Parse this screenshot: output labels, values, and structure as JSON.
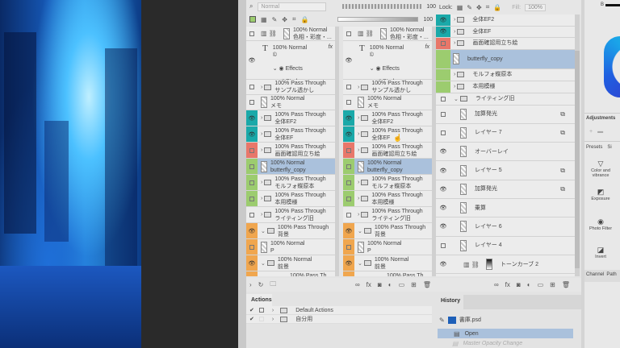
{
  "layers_panel": {
    "blend_mode": "Normal",
    "opacity": "100",
    "fill": "100",
    "rows": [
      {
        "title": "100% Normal",
        "sub": "色相・彩度・...",
        "vis": "box",
        "color": "",
        "kind": "adj"
      },
      {
        "title": "100% Normal",
        "sub": "©",
        "vis": "eye",
        "color": "",
        "kind": "text",
        "fx": "fx"
      },
      {
        "title": "Effects",
        "sub": "",
        "vis": "",
        "color": "",
        "kind": "effects"
      },
      {
        "title": "Stroke",
        "sub": "",
        "vis": "",
        "color": "",
        "kind": "stroke"
      },
      {
        "title": "100% Pass Through",
        "sub": "サンプル透かし",
        "vis": "box",
        "color": "",
        "kind": "folder"
      },
      {
        "title": "100% Normal",
        "sub": "メモ",
        "vis": "box",
        "color": "",
        "kind": "layer"
      },
      {
        "title": "100% Pass Through",
        "sub": "全体EF2",
        "vis": "eye",
        "color": "#1aa9a9",
        "kind": "folder"
      },
      {
        "title": "100% Pass Through",
        "sub": "全体EF",
        "vis": "eye",
        "color": "#1aa9a9",
        "kind": "folder"
      },
      {
        "title": "100% Pass Through",
        "sub": "画面確認用立ち絵",
        "vis": "box",
        "color": "#e8776a",
        "kind": "folder"
      },
      {
        "title": "100% Normal",
        "sub": "butterfly_copy",
        "vis": "box",
        "color": "#9ccc6f",
        "kind": "layer",
        "sel": true
      },
      {
        "title": "100% Pass Through",
        "sub": "モルフォ蝶原本",
        "vis": "box",
        "color": "#9ccc6f",
        "kind": "folder"
      },
      {
        "title": "100% Pass Through",
        "sub": "本用模様",
        "vis": "box",
        "color": "#9ccc6f",
        "kind": "folder"
      },
      {
        "title": "100% Pass Through",
        "sub": "ライティング旧",
        "vis": "box",
        "color": "",
        "kind": "folder"
      },
      {
        "title": "100% Pass Through",
        "sub": "背景",
        "vis": "eye",
        "color": "#f0a64e",
        "kind": "open"
      },
      {
        "title": "100% Normal",
        "sub": "P",
        "vis": "box",
        "color": "#f0a64e",
        "kind": "layer"
      },
      {
        "title": "100% Normal",
        "sub": "前景",
        "vis": "eye",
        "color": "#f0a64e",
        "kind": "open"
      },
      {
        "title": "100% Pass Th",
        "sub": "",
        "vis": "",
        "color": "#f0a64e",
        "kind": "partial"
      }
    ]
  },
  "actions": {
    "title": "Actions",
    "items": [
      "Default Actions",
      "自分用"
    ]
  },
  "layers2": {
    "lock_label": "Lock:",
    "fill_label": "Fill:",
    "fill_value": "100%",
    "rows": [
      {
        "name": "全体EF2",
        "vis": "eye",
        "color": "#1aa9a9",
        "kind": "folder"
      },
      {
        "name": "全体EF",
        "vis": "eye",
        "color": "#1aa9a9",
        "kind": "folder"
      },
      {
        "name": "画面確認用立ち絵",
        "vis": "box",
        "color": "#e8776a",
        "kind": "folder"
      },
      {
        "name": "butterfly_copy",
        "vis": "",
        "color": "#9ccc6f",
        "kind": "layer",
        "sel": true
      },
      {
        "name": "モルフォ蝶原本",
        "vis": "",
        "color": "#9ccc6f",
        "kind": "folder"
      },
      {
        "name": "本用模様",
        "vis": "",
        "color": "#9ccc6f",
        "kind": "folder"
      },
      {
        "name": "ライティング旧",
        "vis": "box",
        "color": "",
        "kind": "open"
      },
      {
        "name": "加算発光",
        "vis": "box",
        "color": "",
        "kind": "layer",
        "clip": true
      },
      {
        "name": "レイヤー 7",
        "vis": "box",
        "color": "",
        "kind": "layer",
        "clip": true
      },
      {
        "name": "オーバーレイ",
        "vis": "eye",
        "color": "",
        "kind": "layer"
      },
      {
        "name": "レイヤー 5",
        "vis": "eye",
        "color": "",
        "kind": "layer",
        "clip": true
      },
      {
        "name": "加算発光",
        "vis": "eye",
        "color": "",
        "kind": "layer",
        "clip": true
      },
      {
        "name": "乗算",
        "vis": "eye",
        "color": "",
        "kind": "layer"
      },
      {
        "name": "レイヤー 6",
        "vis": "eye",
        "color": "",
        "kind": "layer"
      },
      {
        "name": "レイヤー 4",
        "vis": "box",
        "color": "",
        "kind": "layer"
      },
      {
        "name": "トーンカーブ 2",
        "vis": "eye",
        "color": "",
        "kind": "adj"
      }
    ]
  },
  "history": {
    "title": "History",
    "document": "書庫.psd",
    "items": [
      "Open",
      "Master Opacity Change"
    ]
  },
  "right": {
    "adjustments_title": "Adjustments",
    "tabs": [
      "Presets",
      "Si"
    ],
    "presets": [
      "Color and vibrance",
      "Exposure",
      "Photo Filter",
      "Invert"
    ],
    "bottom_tabs": [
      "Channel",
      "Path"
    ],
    "color_label": "B"
  }
}
